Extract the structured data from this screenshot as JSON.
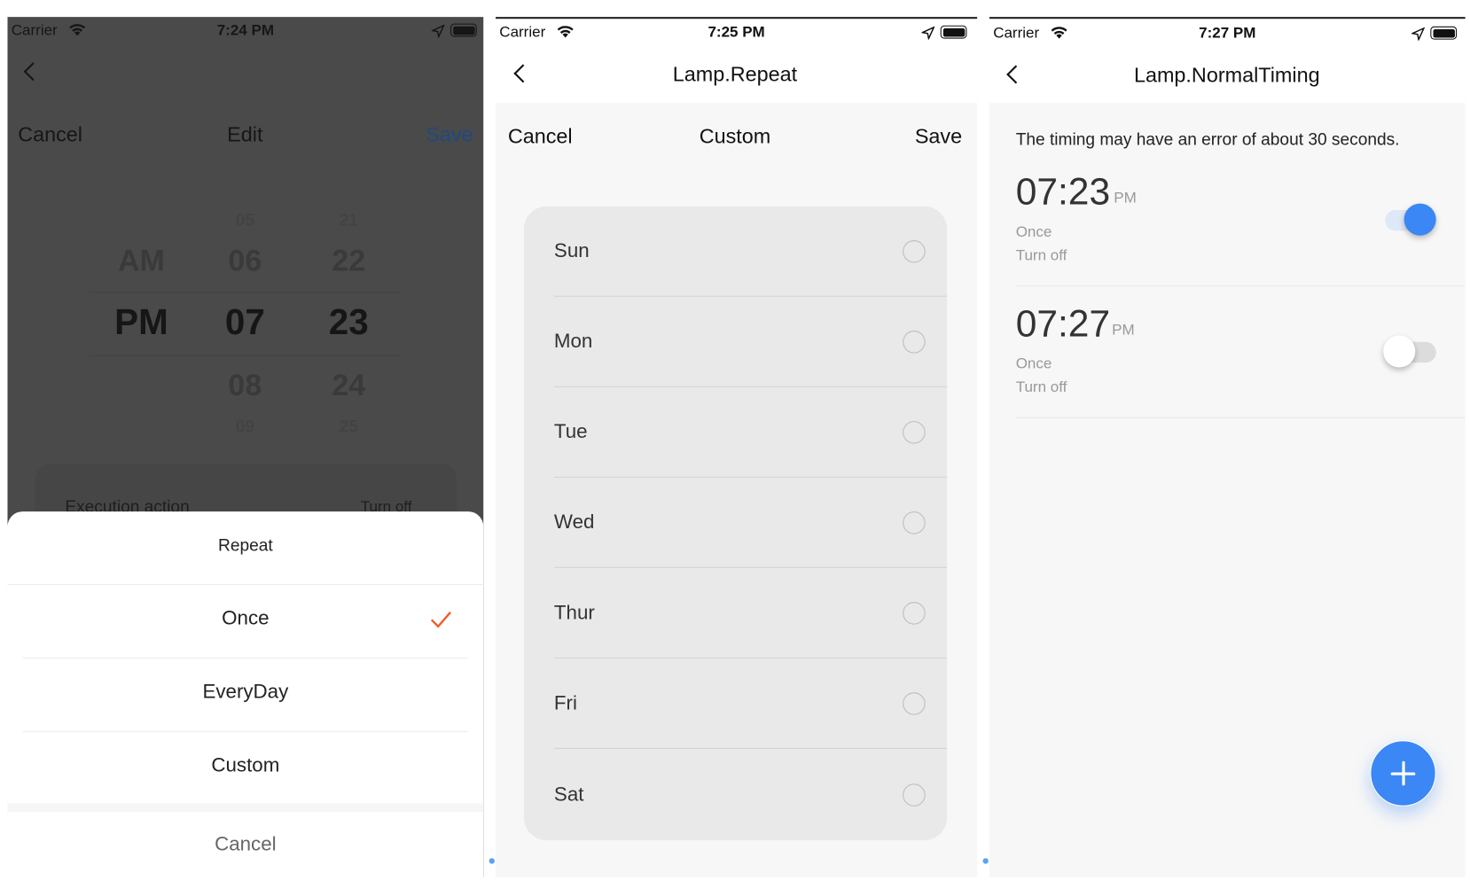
{
  "colors": {
    "accent_blue": "#3b87f5",
    "check_orange": "#f05a28",
    "overlay": "#4a4a4a"
  },
  "screen1": {
    "status": {
      "carrier": "Carrier",
      "time": "7:24 PM"
    },
    "nav": {
      "cancel": "Cancel",
      "title": "Edit",
      "save": "Save"
    },
    "picker": {
      "ampm": [
        "AM",
        "PM"
      ],
      "hours": [
        "05",
        "06",
        "07",
        "08",
        "09"
      ],
      "minutes": [
        "21",
        "22",
        "23",
        "24",
        "25"
      ],
      "selected": {
        "ampm": "PM",
        "hour": "07",
        "minute": "23"
      }
    },
    "execution": {
      "label": "Execution action",
      "value": "Turn off"
    },
    "sheet": {
      "title": "Repeat",
      "options": [
        "Once",
        "EveryDay",
        "Custom"
      ],
      "selected": "Once",
      "cancel": "Cancel"
    }
  },
  "screen2": {
    "status": {
      "carrier": "Carrier",
      "time": "7:25 PM"
    },
    "title": "Lamp.Repeat",
    "nav": {
      "cancel": "Cancel",
      "title": "Custom",
      "save": "Save"
    },
    "days": [
      {
        "label": "Sun",
        "checked": false
      },
      {
        "label": "Mon",
        "checked": false
      },
      {
        "label": "Tue",
        "checked": false
      },
      {
        "label": "Wed",
        "checked": false
      },
      {
        "label": "Thur",
        "checked": false
      },
      {
        "label": "Fri",
        "checked": false
      },
      {
        "label": "Sat",
        "checked": false
      }
    ]
  },
  "screen3": {
    "status": {
      "carrier": "Carrier",
      "time": "7:27 PM"
    },
    "title": "Lamp.NormalTiming",
    "notice": "The timing may have an error of about 30 seconds.",
    "timers": [
      {
        "time": "07:23",
        "ampm": "PM",
        "repeat": "Once",
        "action": "Turn off",
        "enabled": true
      },
      {
        "time": "07:27",
        "ampm": "PM",
        "repeat": "Once",
        "action": "Turn off",
        "enabled": false
      }
    ],
    "add_icon": "plus-icon"
  }
}
